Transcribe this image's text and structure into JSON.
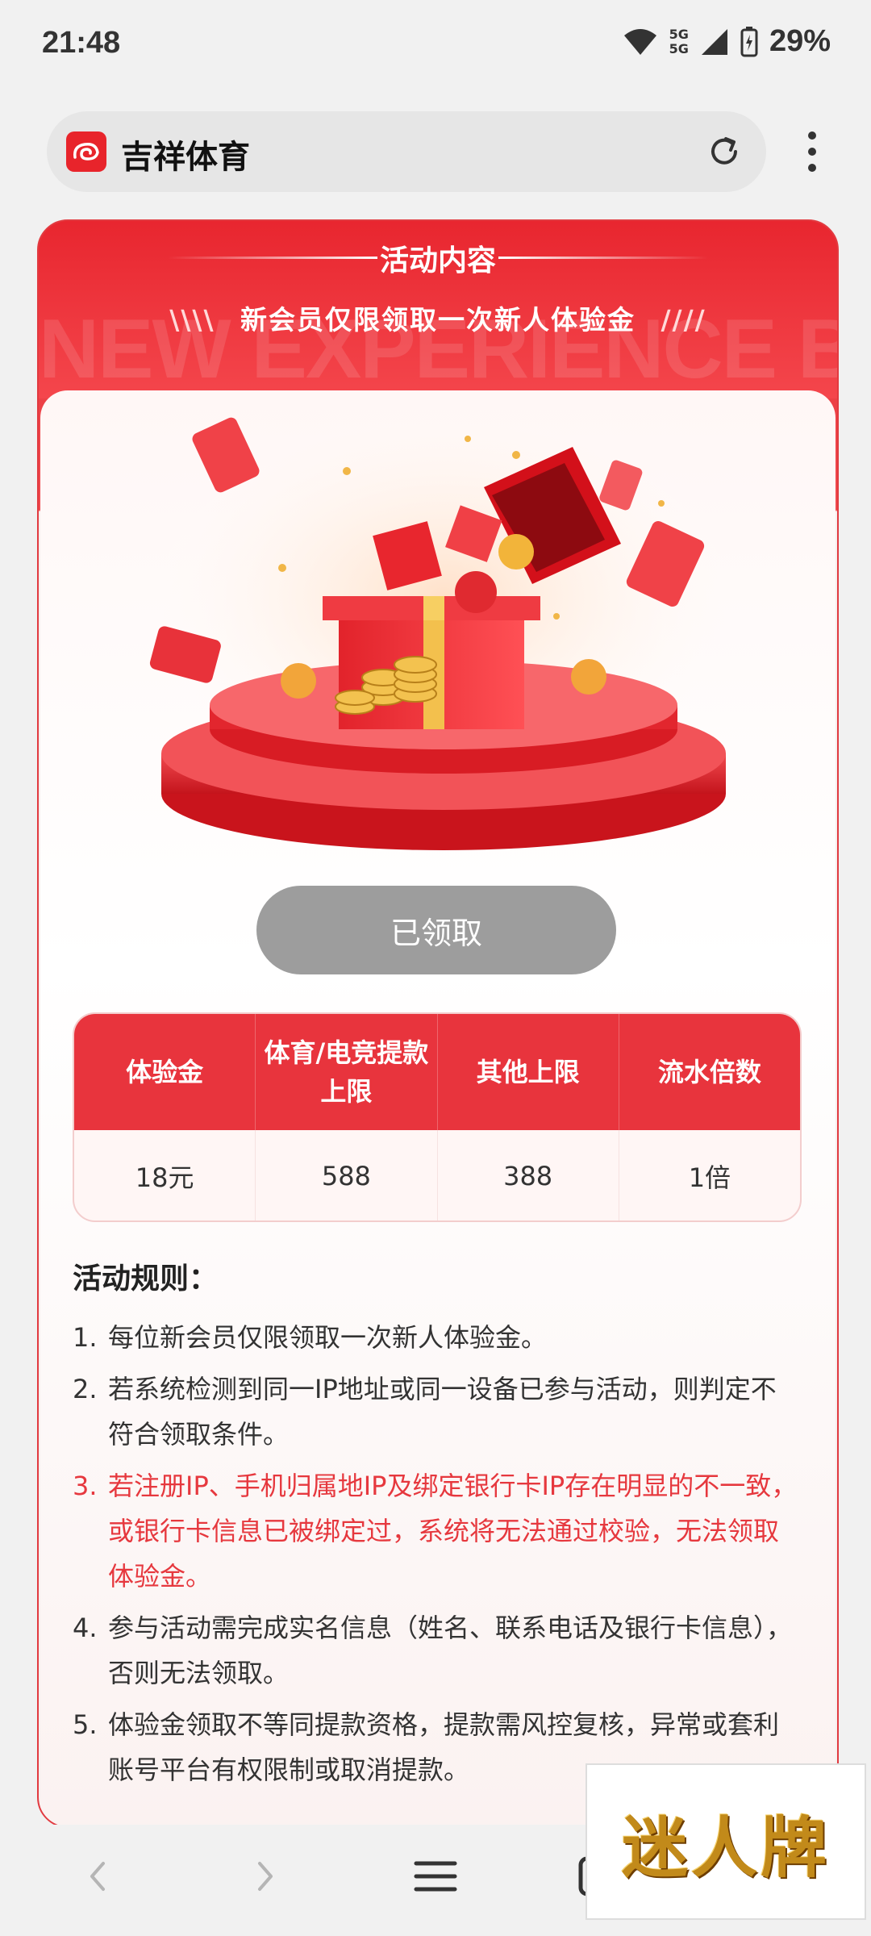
{
  "status_bar": {
    "time": "21:48",
    "network_labels": [
      "5G",
      "5G"
    ],
    "battery": "29%"
  },
  "browser": {
    "site_title": "吉祥体育",
    "icons": [
      "site-logo-icon",
      "reload-icon",
      "more-vert-icon"
    ]
  },
  "activity": {
    "header_title": "活动内容",
    "subtitle_left": "\\\\\\\\",
    "subtitle": "新会员仅限领取一次新人体验金",
    "subtitle_right": "////",
    "watermark": "NEW EXPERIENCE BONUS",
    "button_label": "已领取",
    "table": {
      "headers": [
        "体验金",
        "体育/电竞提款上限",
        "其他上限",
        "流水倍数"
      ],
      "rows": [
        [
          "18元",
          "588",
          "388",
          "1倍"
        ]
      ]
    },
    "rules_title": "活动规则：",
    "rules": [
      {
        "num": "1.",
        "text": "每位新会员仅限领取一次新人体验金。",
        "highlight": false
      },
      {
        "num": "2.",
        "text": "若系统检测到同一IP地址或同一设备已参与活动，则判定不符合领取条件。",
        "highlight": false
      },
      {
        "num": "3.",
        "text": "若注册IP、手机归属地IP及绑定银行卡IP存在明显的不一致，或银行卡信息已被绑定过，系统将无法通过校验，无法领取体验金。",
        "highlight": true
      },
      {
        "num": "4.",
        "text": "参与活动需完成实名信息（姓名、联系电话及银行卡信息），否则无法领取。",
        "highlight": false
      },
      {
        "num": "5.",
        "text": "体验金领取不等同提款资格，提款需风控复核，异常或套利账号平台有权限制或取消提款。",
        "highlight": false
      }
    ],
    "highlight_color": "#e6383e",
    "accent_color": "#e8343d"
  },
  "bottom_nav": {
    "icons": [
      "back-icon",
      "forward-icon",
      "menu-icon",
      "tabs-icon"
    ]
  },
  "overlay_logo": "迷人牌"
}
